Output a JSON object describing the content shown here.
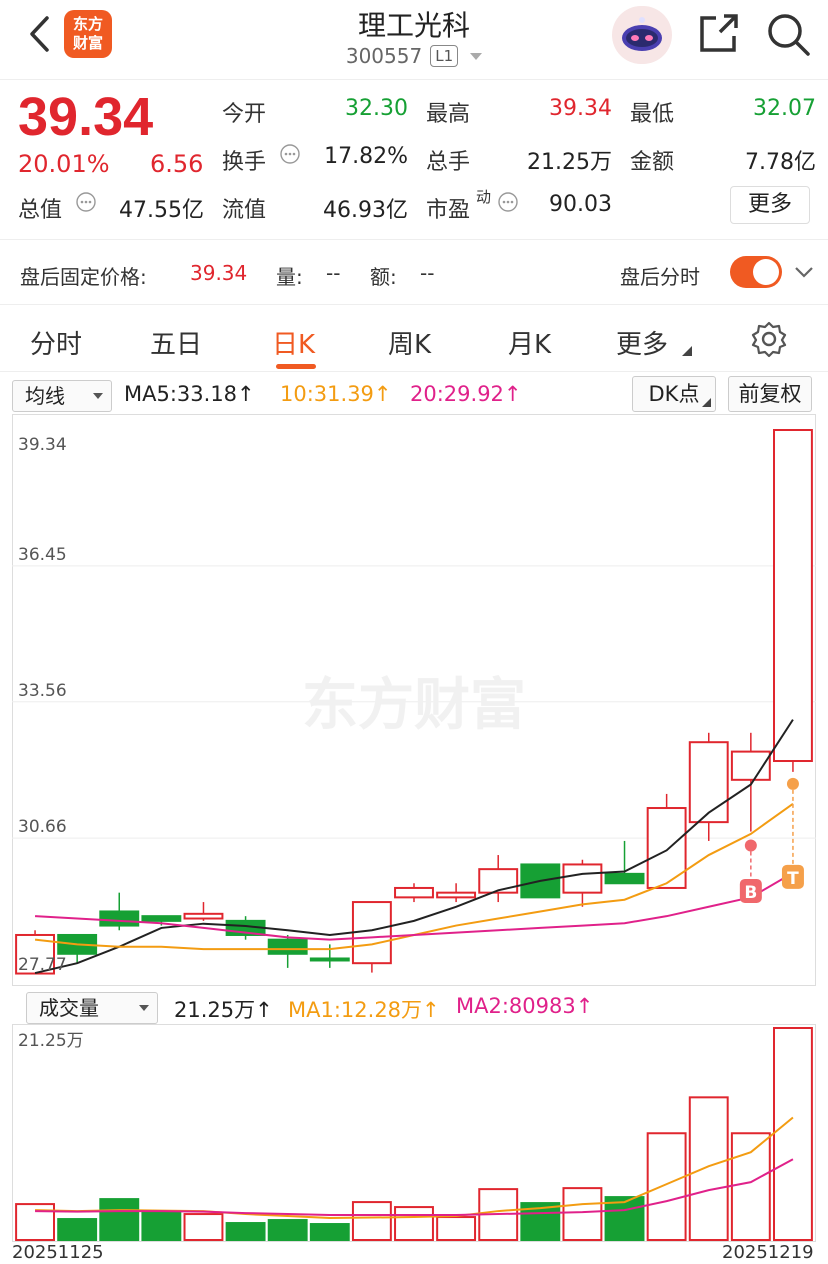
{
  "header": {
    "logo_text_1": "东方",
    "logo_text_2": "财富",
    "stock_name": "理工光科",
    "stock_code": "300557",
    "level_badge": "L1"
  },
  "quote": {
    "price": "39.34",
    "change_pct": "20.01%",
    "change": "6.56",
    "stats": [
      {
        "label": "今开",
        "value": "32.30",
        "color": "green"
      },
      {
        "label": "最高",
        "value": "39.34",
        "color": "red"
      },
      {
        "label": "最低",
        "value": "32.07",
        "color": "green"
      },
      {
        "label": "换手",
        "value": "17.82%",
        "color": "dark"
      },
      {
        "label": "总手",
        "value": "21.25万",
        "color": "dark"
      },
      {
        "label": "金额",
        "value": "7.78亿",
        "color": "dark"
      },
      {
        "label": "总值",
        "value": "47.55亿",
        "color": "dark"
      },
      {
        "label": "流值",
        "value": "46.93亿",
        "color": "dark"
      },
      {
        "label": "市盈",
        "value": "90.03",
        "color": "dark"
      }
    ],
    "pe_superscript": "动",
    "more_label": "更多"
  },
  "after_hours": {
    "label": "盘后固定价格:",
    "price": "39.34",
    "vol_label": "量:",
    "vol_value": "--",
    "amt_label": "额:",
    "amt_value": "--",
    "intraday_label": "盘后分时"
  },
  "tabs": {
    "items": [
      "分时",
      "五日",
      "日K",
      "周K",
      "月K",
      "更多"
    ],
    "active": "日K"
  },
  "ma_bar": {
    "selector": "均线",
    "ma5": "MA5:33.18",
    "ma10": "10:31.39",
    "ma20": "20:29.92",
    "dk_label": "DK点",
    "adjust_label": "前复权"
  },
  "volume_bar": {
    "selector": "成交量",
    "vol": "21.25万",
    "ma1": "MA1:12.28万",
    "ma2": "MA2:80983"
  },
  "watermark": "东方财富",
  "colors": {
    "up": "#e0262e",
    "down": "#16a034",
    "ma5": "#222222",
    "ma10": "#f39c12",
    "ma20": "#e0218a",
    "accent": "#f05a22"
  },
  "chart_data": {
    "type": "candlestick",
    "y_ticks": [
      "39.34",
      "36.45",
      "33.56",
      "30.66",
      "27.77"
    ],
    "ylim": [
      27.77,
      39.34
    ],
    "candles": [
      {
        "o": 28.6,
        "c": 27.78,
        "h": 28.7,
        "l": 27.77,
        "up": true
      },
      {
        "o": 28.2,
        "c": 28.6,
        "h": 28.6,
        "l": 28.0,
        "up": false
      },
      {
        "o": 28.8,
        "c": 29.1,
        "h": 29.5,
        "l": 28.7,
        "up": false
      },
      {
        "o": 28.9,
        "c": 29.0,
        "h": 29.0,
        "l": 28.8,
        "up": false
      },
      {
        "o": 28.95,
        "c": 29.05,
        "h": 29.3,
        "l": 28.9,
        "up": true
      },
      {
        "o": 28.9,
        "c": 28.6,
        "h": 29.0,
        "l": 28.5,
        "up": false
      },
      {
        "o": 28.5,
        "c": 28.2,
        "h": 28.6,
        "l": 27.9,
        "up": false
      },
      {
        "o": 28.1,
        "c": 28.1,
        "h": 28.4,
        "l": 27.9,
        "up": false
      },
      {
        "o": 28.0,
        "c": 29.3,
        "h": 29.3,
        "l": 27.8,
        "up": true
      },
      {
        "o": 29.4,
        "c": 29.6,
        "h": 29.7,
        "l": 29.3,
        "up": true
      },
      {
        "o": 29.4,
        "c": 29.5,
        "h": 29.7,
        "l": 29.3,
        "up": true
      },
      {
        "o": 29.5,
        "c": 30.0,
        "h": 30.3,
        "l": 29.3,
        "up": true
      },
      {
        "o": 30.1,
        "c": 29.4,
        "h": 30.1,
        "l": 29.4,
        "up": false
      },
      {
        "o": 29.5,
        "c": 30.1,
        "h": 30.2,
        "l": 29.2,
        "up": true
      },
      {
        "o": 29.9,
        "c": 29.7,
        "h": 30.6,
        "l": 29.7,
        "up": false
      },
      {
        "o": 29.6,
        "c": 31.3,
        "h": 31.6,
        "l": 29.6,
        "up": true
      },
      {
        "o": 31.0,
        "c": 32.7,
        "h": 32.9,
        "l": 30.6,
        "up": true
      },
      {
        "o": 31.9,
        "c": 32.5,
        "h": 32.9,
        "l": 30.8,
        "up": true
      },
      {
        "o": 32.3,
        "c": 39.34,
        "h": 39.34,
        "l": 32.07,
        "up": true
      }
    ],
    "ma5": [
      27.79,
      28.0,
      28.35,
      28.75,
      28.84,
      28.79,
      28.7,
      28.6,
      28.7,
      28.9,
      29.2,
      29.55,
      29.75,
      29.9,
      29.95,
      30.4,
      31.2,
      31.8,
      33.18
    ],
    "ma10": [
      28.5,
      28.4,
      28.35,
      28.35,
      28.3,
      28.3,
      28.3,
      28.3,
      28.4,
      28.6,
      28.8,
      28.95,
      29.1,
      29.25,
      29.35,
      29.7,
      30.3,
      30.75,
      31.39
    ],
    "ma20": [
      29.0,
      28.95,
      28.9,
      28.85,
      28.75,
      28.65,
      28.55,
      28.5,
      28.55,
      28.6,
      28.65,
      28.7,
      28.75,
      28.8,
      28.85,
      29.0,
      29.2,
      29.4,
      29.92
    ],
    "signals": [
      {
        "index": 17,
        "label": "B",
        "price": 30.6
      },
      {
        "index": 18,
        "label": "T",
        "price": 30.9
      }
    ],
    "volume_ticks": [
      "21.25万"
    ],
    "volume_max": 21.25,
    "volumes": [
      3.6,
      2.1,
      4.1,
      2.8,
      2.6,
      1.7,
      2.0,
      1.6,
      3.8,
      3.3,
      2.3,
      5.1,
      3.7,
      5.2,
      4.3,
      10.7,
      14.3,
      10.7,
      21.25
    ],
    "volume_ma1": [
      3.0,
      2.9,
      3.0,
      2.95,
      2.9,
      2.6,
      2.4,
      2.2,
      2.25,
      2.3,
      2.4,
      2.9,
      3.2,
      3.6,
      3.8,
      5.6,
      7.4,
      8.8,
      12.28
    ],
    "volume_ma2": [
      2.9,
      2.85,
      2.9,
      2.9,
      2.85,
      2.7,
      2.6,
      2.5,
      2.5,
      2.5,
      2.5,
      2.6,
      2.7,
      2.8,
      3.0,
      3.9,
      5.0,
      5.8,
      8.1
    ],
    "date_start": "20251125",
    "date_end": "20251219"
  }
}
